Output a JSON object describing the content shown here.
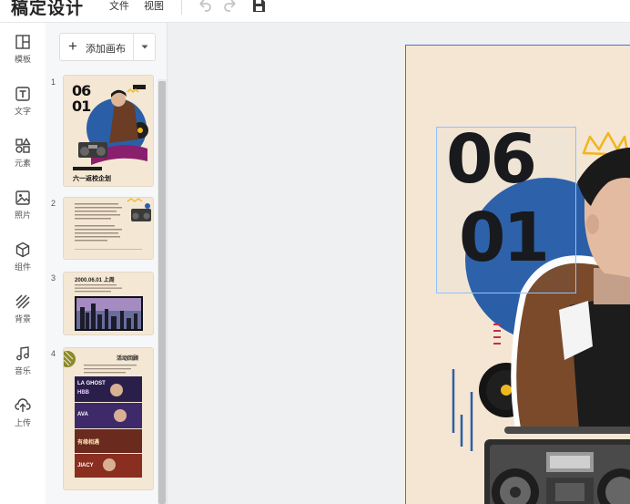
{
  "app": {
    "title": "稿定设计"
  },
  "menu": {
    "file": "文件",
    "view": "视图"
  },
  "toolbar": {
    "undo_icon": "undo-icon",
    "redo_icon": "redo-icon",
    "save_icon": "save-icon"
  },
  "sidebar": {
    "items": [
      {
        "label": "模板",
        "icon": "template-icon"
      },
      {
        "label": "文字",
        "icon": "text-icon"
      },
      {
        "label": "元素",
        "icon": "elements-icon"
      },
      {
        "label": "照片",
        "icon": "photo-icon"
      },
      {
        "label": "组件",
        "icon": "component-icon"
      },
      {
        "label": "背景",
        "icon": "background-icon"
      },
      {
        "label": "音乐",
        "icon": "music-icon"
      },
      {
        "label": "上传",
        "icon": "upload-icon"
      }
    ]
  },
  "pages_panel": {
    "add_button": "添加画布",
    "pages": [
      {
        "number": "1",
        "digits_top": "06",
        "digits_bottom": "01",
        "caption": "六一返校企划"
      },
      {
        "number": "2"
      },
      {
        "number": "3",
        "header": "2000.06.01 上周"
      },
      {
        "number": "4",
        "header": "活动回顾",
        "banners": [
          "LA GHOST",
          "HBB",
          "AVA",
          "有缘相遇",
          "JIACY"
        ]
      }
    ]
  },
  "canvas": {
    "digits_top": "06",
    "digits_bottom": "01"
  },
  "colors": {
    "accent": "#5a6ad8",
    "canvas_bg": "#f5e6d3",
    "blue_circle": "#2a5fa8",
    "crown": "#f0b61e",
    "selection": "#8fc0ff"
  }
}
